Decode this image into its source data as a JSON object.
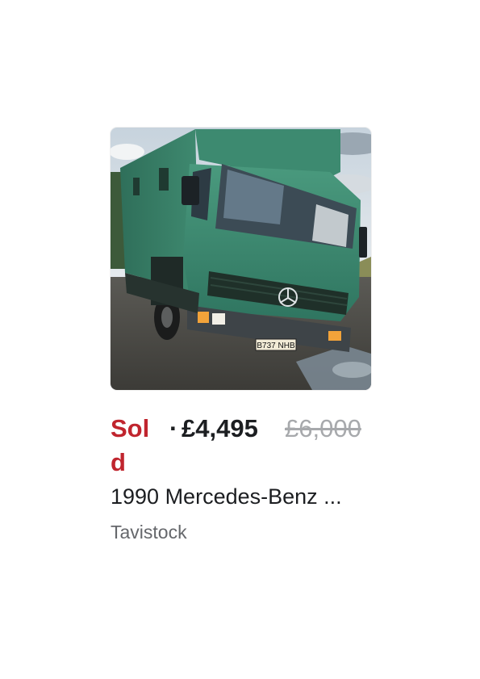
{
  "listing": {
    "image_alt": "Green Mercedes-Benz box truck parked on a gravel lot",
    "status": "Sold",
    "separator": "·",
    "price": "£4,495",
    "original_price": "£6,000",
    "title": "1990 Mercedes-Benz ...",
    "location": "Tavistock",
    "plate_text": "B737 NHB"
  },
  "colors": {
    "sold": "#c0252e",
    "price": "#1c1e21",
    "original_price": "#a7a9ac",
    "location": "#65676b",
    "truck_body": "#3f8a70"
  }
}
